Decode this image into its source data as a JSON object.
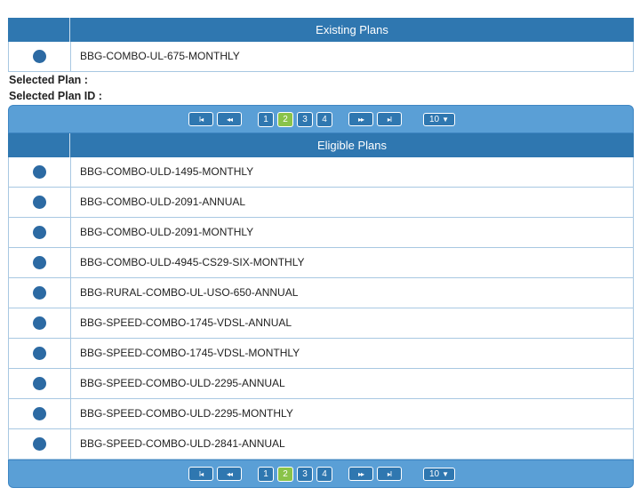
{
  "existing": {
    "header": "Existing Plans",
    "plans": [
      "BBG-COMBO-UL-675-MONTHLY"
    ]
  },
  "selected": {
    "plan_label": "Selected Plan :",
    "plan_id_label": "Selected Plan ID :"
  },
  "pager": {
    "first": "I◂",
    "prev": "◂◂",
    "next": "▸▸",
    "last": "▸I",
    "pages": [
      "1",
      "2",
      "3",
      "4"
    ],
    "active_page": "2",
    "page_size": "10"
  },
  "eligible": {
    "header": "Eligible Plans",
    "plans": [
      "BBG-COMBO-ULD-1495-MONTHLY",
      "BBG-COMBO-ULD-2091-ANNUAL",
      "BBG-COMBO-ULD-2091-MONTHLY",
      "BBG-COMBO-ULD-4945-CS29-SIX-MONTHLY",
      "BBG-RURAL-COMBO-UL-USO-650-ANNUAL",
      "BBG-SPEED-COMBO-1745-VDSL-ANNUAL",
      "BBG-SPEED-COMBO-1745-VDSL-MONTHLY",
      "BBG-SPEED-COMBO-ULD-2295-ANNUAL",
      "BBG-SPEED-COMBO-ULD-2295-MONTHLY",
      "BBG-SPEED-COMBO-ULD-2841-ANNUAL"
    ]
  }
}
